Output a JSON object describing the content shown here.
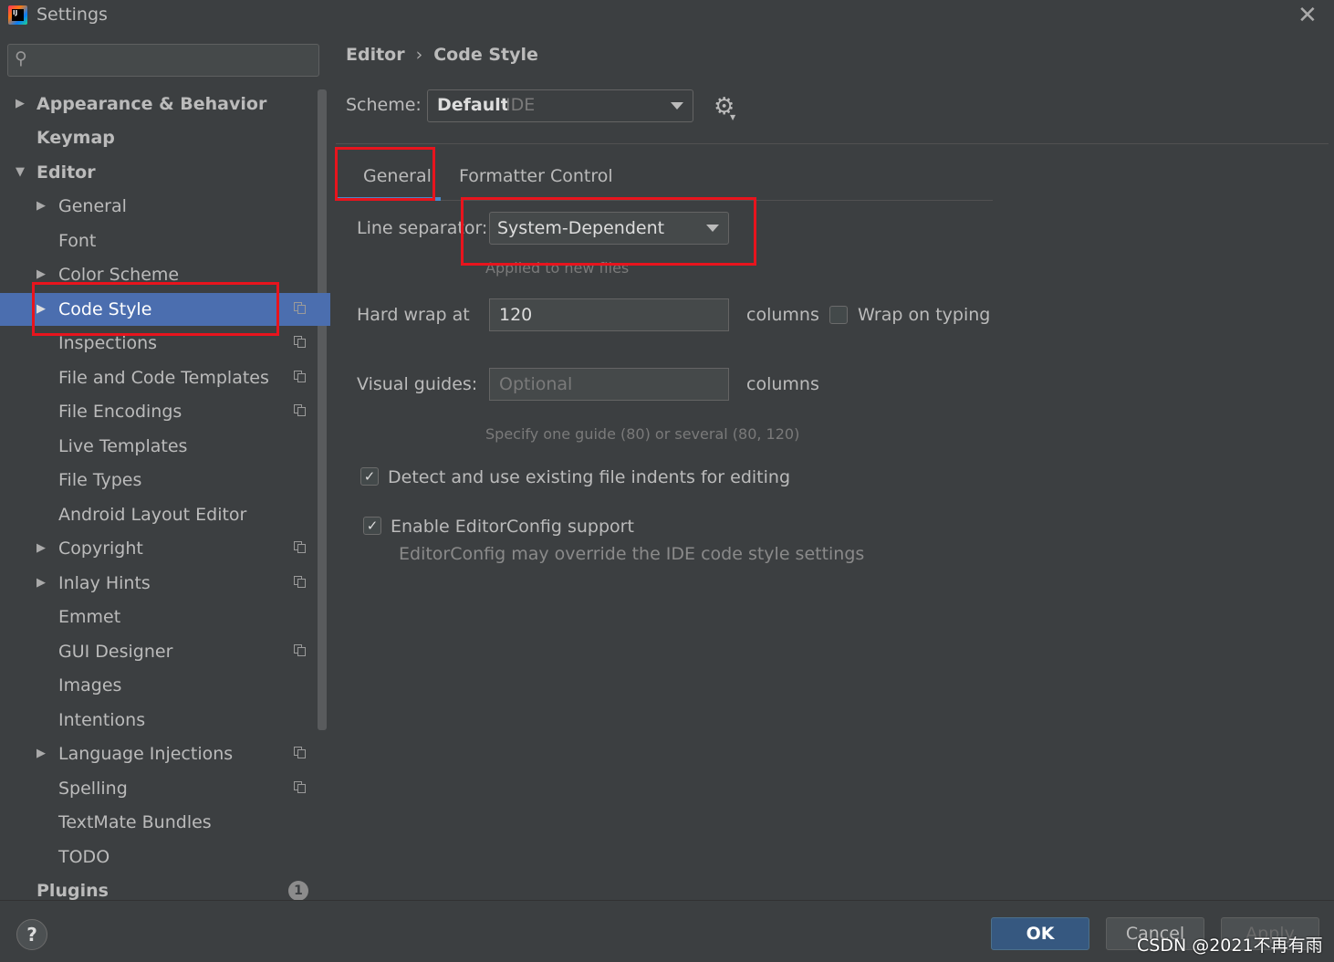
{
  "window": {
    "title": "Settings",
    "app_icon_text": "IJ"
  },
  "sidebar": {
    "search": {
      "value": "",
      "placeholder": ""
    },
    "items": [
      {
        "label": "Appearance & Behavior"
      },
      {
        "label": "Keymap"
      },
      {
        "label": "Editor"
      },
      {
        "label": "General"
      },
      {
        "label": "Font"
      },
      {
        "label": "Color Scheme"
      },
      {
        "label": "Code Style"
      },
      {
        "label": "Inspections"
      },
      {
        "label": "File and Code Templates"
      },
      {
        "label": "File Encodings"
      },
      {
        "label": "Live Templates"
      },
      {
        "label": "File Types"
      },
      {
        "label": "Android Layout Editor"
      },
      {
        "label": "Copyright"
      },
      {
        "label": "Inlay Hints"
      },
      {
        "label": "Emmet"
      },
      {
        "label": "GUI Designer"
      },
      {
        "label": "Images"
      },
      {
        "label": "Intentions"
      },
      {
        "label": "Language Injections"
      },
      {
        "label": "Spelling"
      },
      {
        "label": "TextMate Bundles"
      },
      {
        "label": "TODO"
      },
      {
        "label": "Plugins",
        "badge": "1"
      }
    ],
    "selected": "Code Style"
  },
  "main": {
    "breadcrumb": [
      "Editor",
      "Code Style"
    ],
    "breadcrumb_separator": "›",
    "scheme": {
      "label": "Scheme:",
      "value": "Default",
      "sub": "IDE"
    },
    "tabs": [
      {
        "label": "General",
        "active": true
      },
      {
        "label": "Formatter Control",
        "active": false
      }
    ],
    "line_separator": {
      "label": "Line separator:",
      "value": "System-Dependent",
      "hint": "Applied to new files"
    },
    "hard_wrap": {
      "label": "Hard wrap at",
      "value": "120",
      "unit": "columns",
      "wrap_on_typing_label": "Wrap on typing",
      "wrap_on_typing_checked": false
    },
    "visual_guides": {
      "label": "Visual guides:",
      "placeholder": "Optional",
      "unit": "columns",
      "hint": "Specify one guide (80) or several (80, 120)"
    },
    "detect_indents": {
      "label": "Detect and use existing file indents for editing",
      "checked": true
    },
    "editorconfig": {
      "label": "Enable EditorConfig support",
      "checked": true,
      "hint": "EditorConfig may override the IDE code style settings"
    }
  },
  "footer": {
    "help": "?",
    "ok": "OK",
    "cancel": "Cancel",
    "apply": "Apply"
  },
  "watermark": "CSDN @2021不再有雨",
  "colors": {
    "background": "#3c3f41",
    "selection": "#4b6eaf",
    "primary_button": "#365880",
    "highlight_box": "#e8141d",
    "tab_underline": "#4a88c7"
  }
}
